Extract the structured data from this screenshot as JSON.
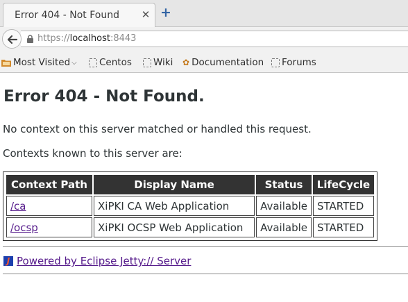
{
  "browser": {
    "tab_title": "Error 404 - Not Found",
    "tab_close": "✕",
    "new_tab": "+",
    "url_scheme": "https://",
    "url_host": "localhost",
    "url_port": ":8443"
  },
  "bookmarks": [
    {
      "label": "Most Visited",
      "icon": "folder-icon",
      "chevron": "⌵"
    },
    {
      "label": "Centos",
      "icon": "page-icon"
    },
    {
      "label": "Wiki",
      "icon": "page-icon"
    },
    {
      "label": "Documentation",
      "icon": "flower-icon"
    },
    {
      "label": "Forums",
      "icon": "page-icon"
    }
  ],
  "page": {
    "heading": "Error 404 - Not Found.",
    "message": "No context on this server matched or handled this request.",
    "contexts_intro": "Contexts known to this server are:",
    "table": {
      "headers": [
        "Context Path",
        "Display Name",
        "Status",
        "LifeCycle"
      ],
      "rows": [
        {
          "path": "/ca",
          "name": "XiPKI CA Web Application",
          "status": "Available",
          "lifecycle": "STARTED"
        },
        {
          "path": "/ocsp",
          "name": "XiPKI OCSP Web Application",
          "status": "Available",
          "lifecycle": "STARTED"
        }
      ]
    },
    "footer_link": "Powered by Eclipse Jetty:// Server"
  }
}
